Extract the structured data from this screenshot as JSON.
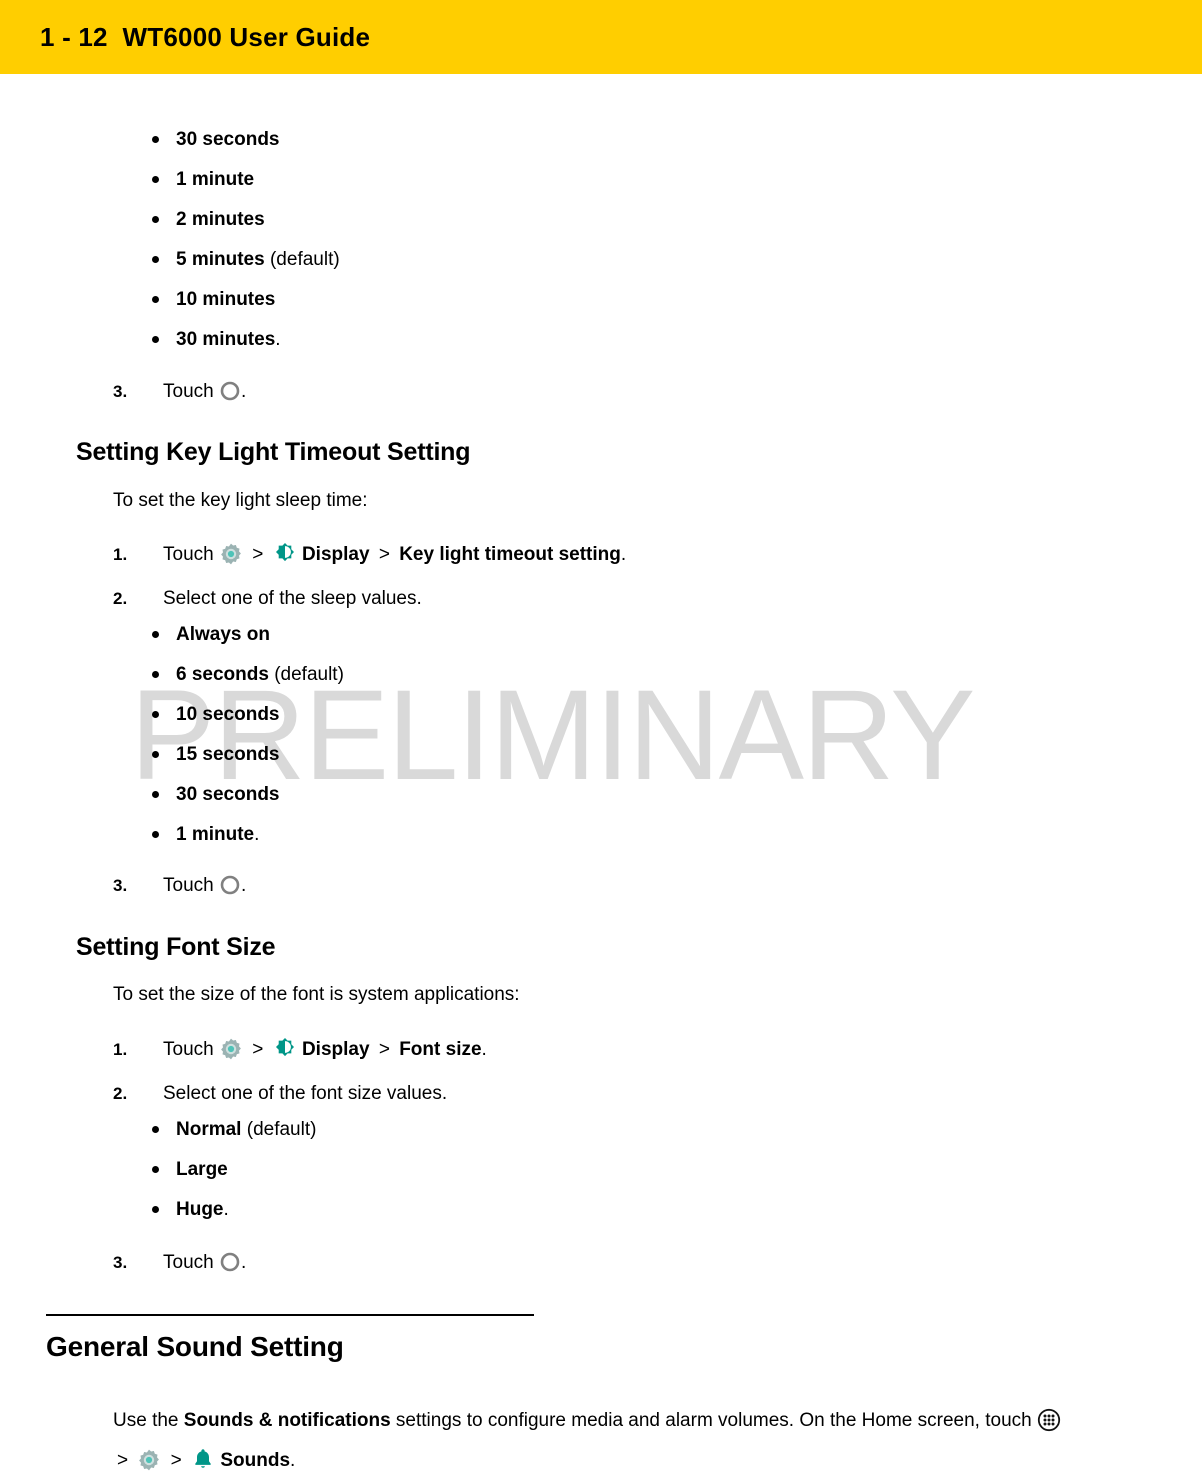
{
  "header": {
    "page_number": "1 - 12",
    "document_title": "WT6000 User Guide",
    "banner_color": "#FFCE00"
  },
  "watermark": {
    "text": "PRELIMINARY",
    "color": "#d9d9d9"
  },
  "colors": {
    "teal_icon": "#009688",
    "gear_icon": "#8aa6a6",
    "home_ring": "#808080"
  },
  "icons": {
    "home": "home-circle-icon",
    "gear": "settings-gear-icon",
    "display": "display-brightness-icon",
    "bell": "sounds-bell-icon",
    "apps": "all-apps-grid-icon"
  },
  "sections": [
    {
      "id": "screen-timeout-values",
      "bullets": [
        {
          "bold": "30 seconds",
          "plain": ""
        },
        {
          "bold": "1 minute",
          "plain": ""
        },
        {
          "bold": "2 minutes",
          "plain": ""
        },
        {
          "bold": "5 minutes",
          "plain": " (default)"
        },
        {
          "bold": "10 minutes",
          "plain": ""
        },
        {
          "bold": "30 minutes",
          "plain": "."
        }
      ],
      "final_step": {
        "num": "3.",
        "text": "Touch",
        "suffix": "."
      }
    },
    {
      "id": "key-light-timeout",
      "heading": "Setting Key Light Timeout Setting",
      "intro": "To set the key light sleep time:",
      "step1": {
        "num": "1.",
        "touch": "Touch",
        "sep": ">",
        "display_label": "Display",
        "sep2": ">",
        "target": "Key light timeout setting",
        "suffix": "."
      },
      "step2": {
        "num": "2.",
        "text": "Select one of the sleep values."
      },
      "bullets": [
        {
          "bold": "Always on",
          "plain": ""
        },
        {
          "bold": "6 seconds",
          "plain": " (default)"
        },
        {
          "bold": "10 seconds",
          "plain": ""
        },
        {
          "bold": "15 seconds",
          "plain": ""
        },
        {
          "bold": "30 seconds",
          "plain": ""
        },
        {
          "bold": "1 minute",
          "plain": "."
        }
      ],
      "step3": {
        "num": "3.",
        "text": "Touch",
        "suffix": "."
      }
    },
    {
      "id": "font-size",
      "heading": "Setting Font Size",
      "intro": "To set the size of the font is system applications:",
      "step1": {
        "num": "1.",
        "touch": "Touch",
        "sep": ">",
        "display_label": "Display",
        "sep2": ">",
        "target": "Font size",
        "suffix": "."
      },
      "step2": {
        "num": "2.",
        "text": "Select one of the font size values."
      },
      "bullets": [
        {
          "bold": "Normal",
          "plain": " (default)"
        },
        {
          "bold": "Large",
          "plain": ""
        },
        {
          "bold": "Huge",
          "plain": "."
        }
      ],
      "step3": {
        "num": "3.",
        "text": "Touch",
        "suffix": "."
      }
    },
    {
      "id": "general-sound-setting",
      "heading": "General Sound Setting",
      "body": {
        "lead": "Use the ",
        "bold1": "Sounds & notifications",
        "mid": " settings to configure media and alarm volumes. On the Home screen, touch ",
        "sep1": ">",
        "sep2": ">",
        "bold2": "Sounds",
        "suffix": "."
      }
    }
  ]
}
